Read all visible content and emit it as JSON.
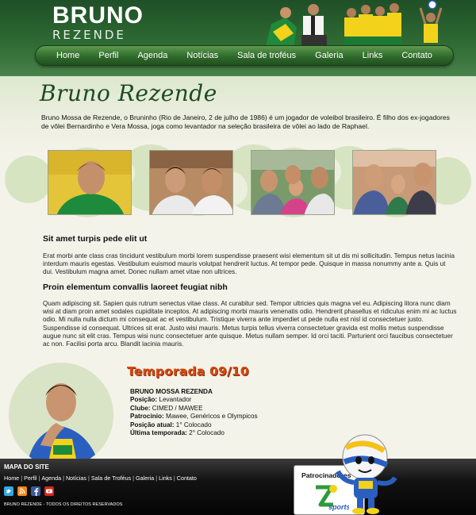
{
  "header": {
    "logo_top": "BRUNO",
    "logo_bottom": "REZENDE",
    "nav": [
      "Home",
      "Perfil",
      "Agenda",
      "Notícias",
      "Sala de troféus",
      "Galeria",
      "Links",
      "Contato"
    ]
  },
  "intro": {
    "title": "Bruno Rezende",
    "text": "Bruno Mossa de Rezende, o Bruninho (Rio de Janeiro, 2 de julho de 1986) é um jogador de voleibol brasileiro. É filho dos ex-jogadores de vôlei Bernardinho e Vera Mossa, joga como levantador na seleção brasileira de vôlei ao lado de Raphael."
  },
  "articles": [
    {
      "heading": "Sit amet turpis pede elit ut",
      "text": "Erat morbi ante class cras tincidunt vestibulum morbi lorem suspendisse praesent wisi elementum sit ut dis mi sollicitudin. Tempus netus lacinia interdum mauris egestas. Vestibulum euismod mauris volutpat hendrerit luctus. At tempor pede. Quisque in massa nonummy ante a. Quis ut dui. Vestibulum magna amet. Donec nullam amet vitae non ultrices."
    },
    {
      "heading": "Proin elementum convallis laoreet feugiat nibh",
      "text": "Quam adipiscing sit. Sapien quis rutrum senectus vitae class. At curabitur sed. Tempor ultricies quis magna vel eu. Adipiscing litora nunc diam wisi at diam proin amet sodales cupiditate inceptos. At adipiscing morbi mauris venenatis odio. Hendrerit phasellus et ridiculus enim mi ac luctus odio. Mi nulla nulla dictum mi consequat ac et vestibulum. Tristique viverra ante imperdiet ut pede nulla est nisl id consectetuer justo. Suspendisse id consequat. Ultrices sit erat. Justo wisi mauris. Metus turpis tellus viverra consectetuer gravida est mollis metus suspendisse augue nunc sit elit cras. Tempus wisi nunc consectetuer ante quisque. Metus nullam semper. Id orci taciti. Parturient orci faucibus consectetuer ac non. Facilisi porta arcu. Blandit lacinia mauris."
    }
  ],
  "season": {
    "title": "Temporada 09/10",
    "name": "BRUNO MOSSA REZENDA",
    "rows": [
      {
        "label": "Posição:",
        "value": "Levantador"
      },
      {
        "label": "Clube:",
        "value": "CIMED / MAWEE"
      },
      {
        "label": "Patrocinio:",
        "value": "Mawee, Genéricos e Olympicos"
      },
      {
        "label": "Posição atual:",
        "value": "1° Colocado"
      },
      {
        "label": "Última temporada:",
        "value": "2° Colocado"
      }
    ]
  },
  "footer": {
    "sitemap_title": "MAPA DO SITE",
    "links": [
      "Home",
      "Perfil",
      "Agenda",
      "Notícias",
      "Sala de Troféus",
      "Galeria",
      "Links",
      "Contato"
    ],
    "separator": "|",
    "social_icons": [
      "twitter-icon",
      "rss-icon",
      "facebook-icon",
      "youtube-icon"
    ],
    "copyright": "BRUNO REZENDE - TODOS OS DIREITOS RESERVADOS",
    "sponsors_title": "Patrocinadores",
    "sponsor_logo_text": "sports"
  },
  "colors": {
    "header_green": "#2e6a33",
    "title_green": "#1e4a28",
    "season_orange": "#d34b12",
    "circle_green": "#d7e4c2"
  }
}
